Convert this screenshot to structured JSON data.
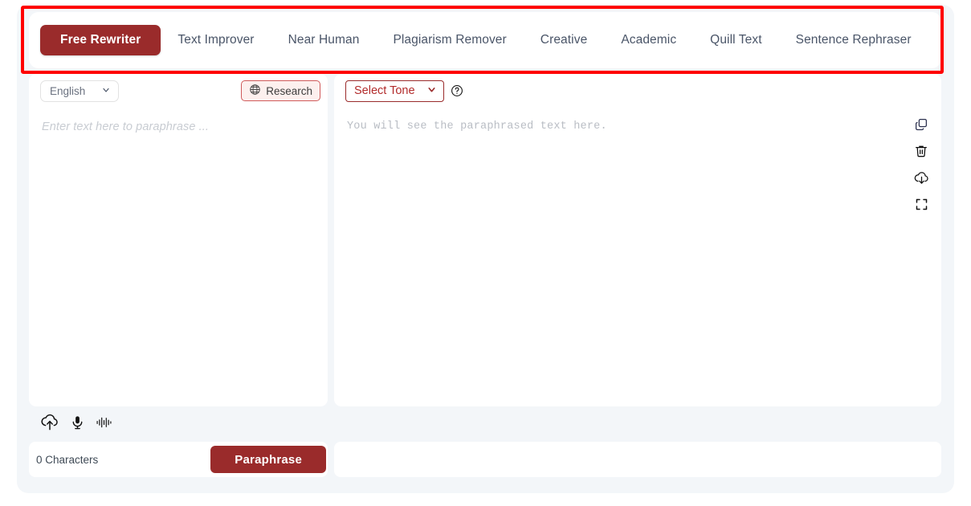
{
  "app": {
    "accent_color": "#9a2b2b",
    "annotation_color": "#ff0000",
    "background": "#f3f6f9"
  },
  "tabs": [
    {
      "label": "Free Rewriter",
      "active": true
    },
    {
      "label": "Text Improver",
      "active": false
    },
    {
      "label": "Near Human",
      "active": false
    },
    {
      "label": "Plagiarism Remover",
      "active": false
    },
    {
      "label": "Creative",
      "active": false
    },
    {
      "label": "Academic",
      "active": false
    },
    {
      "label": "Quill Text",
      "active": false
    },
    {
      "label": "Sentence Rephraser",
      "active": false
    }
  ],
  "toolbar": {
    "language_select": {
      "value": "English",
      "icon": "chevron-down-icon"
    },
    "research_button": {
      "label": "Research",
      "icon": "globe-icon"
    },
    "tone_select": {
      "value": "Select Tone",
      "icon": "chevron-down-icon"
    },
    "help_icon": "question-circle-icon"
  },
  "input_pane": {
    "placeholder": "Enter text here to paraphrase ...",
    "value": ""
  },
  "output_pane": {
    "placeholder": "You will see the paraphrased text here.",
    "value": "",
    "actions": [
      {
        "name": "copy-icon",
        "title": "Copy"
      },
      {
        "name": "trash-icon",
        "title": "Delete"
      },
      {
        "name": "cloud-download-icon",
        "title": "Download"
      },
      {
        "name": "fullscreen-icon",
        "title": "Expand"
      }
    ]
  },
  "tool_strip": [
    {
      "name": "cloud-upload-icon",
      "title": "Upload file"
    },
    {
      "name": "microphone-icon",
      "title": "Voice input"
    },
    {
      "name": "waveform-icon",
      "title": "Audio waveform"
    }
  ],
  "footer": {
    "character_count": "0 Characters",
    "paraphrase_button": "Paraphrase"
  }
}
